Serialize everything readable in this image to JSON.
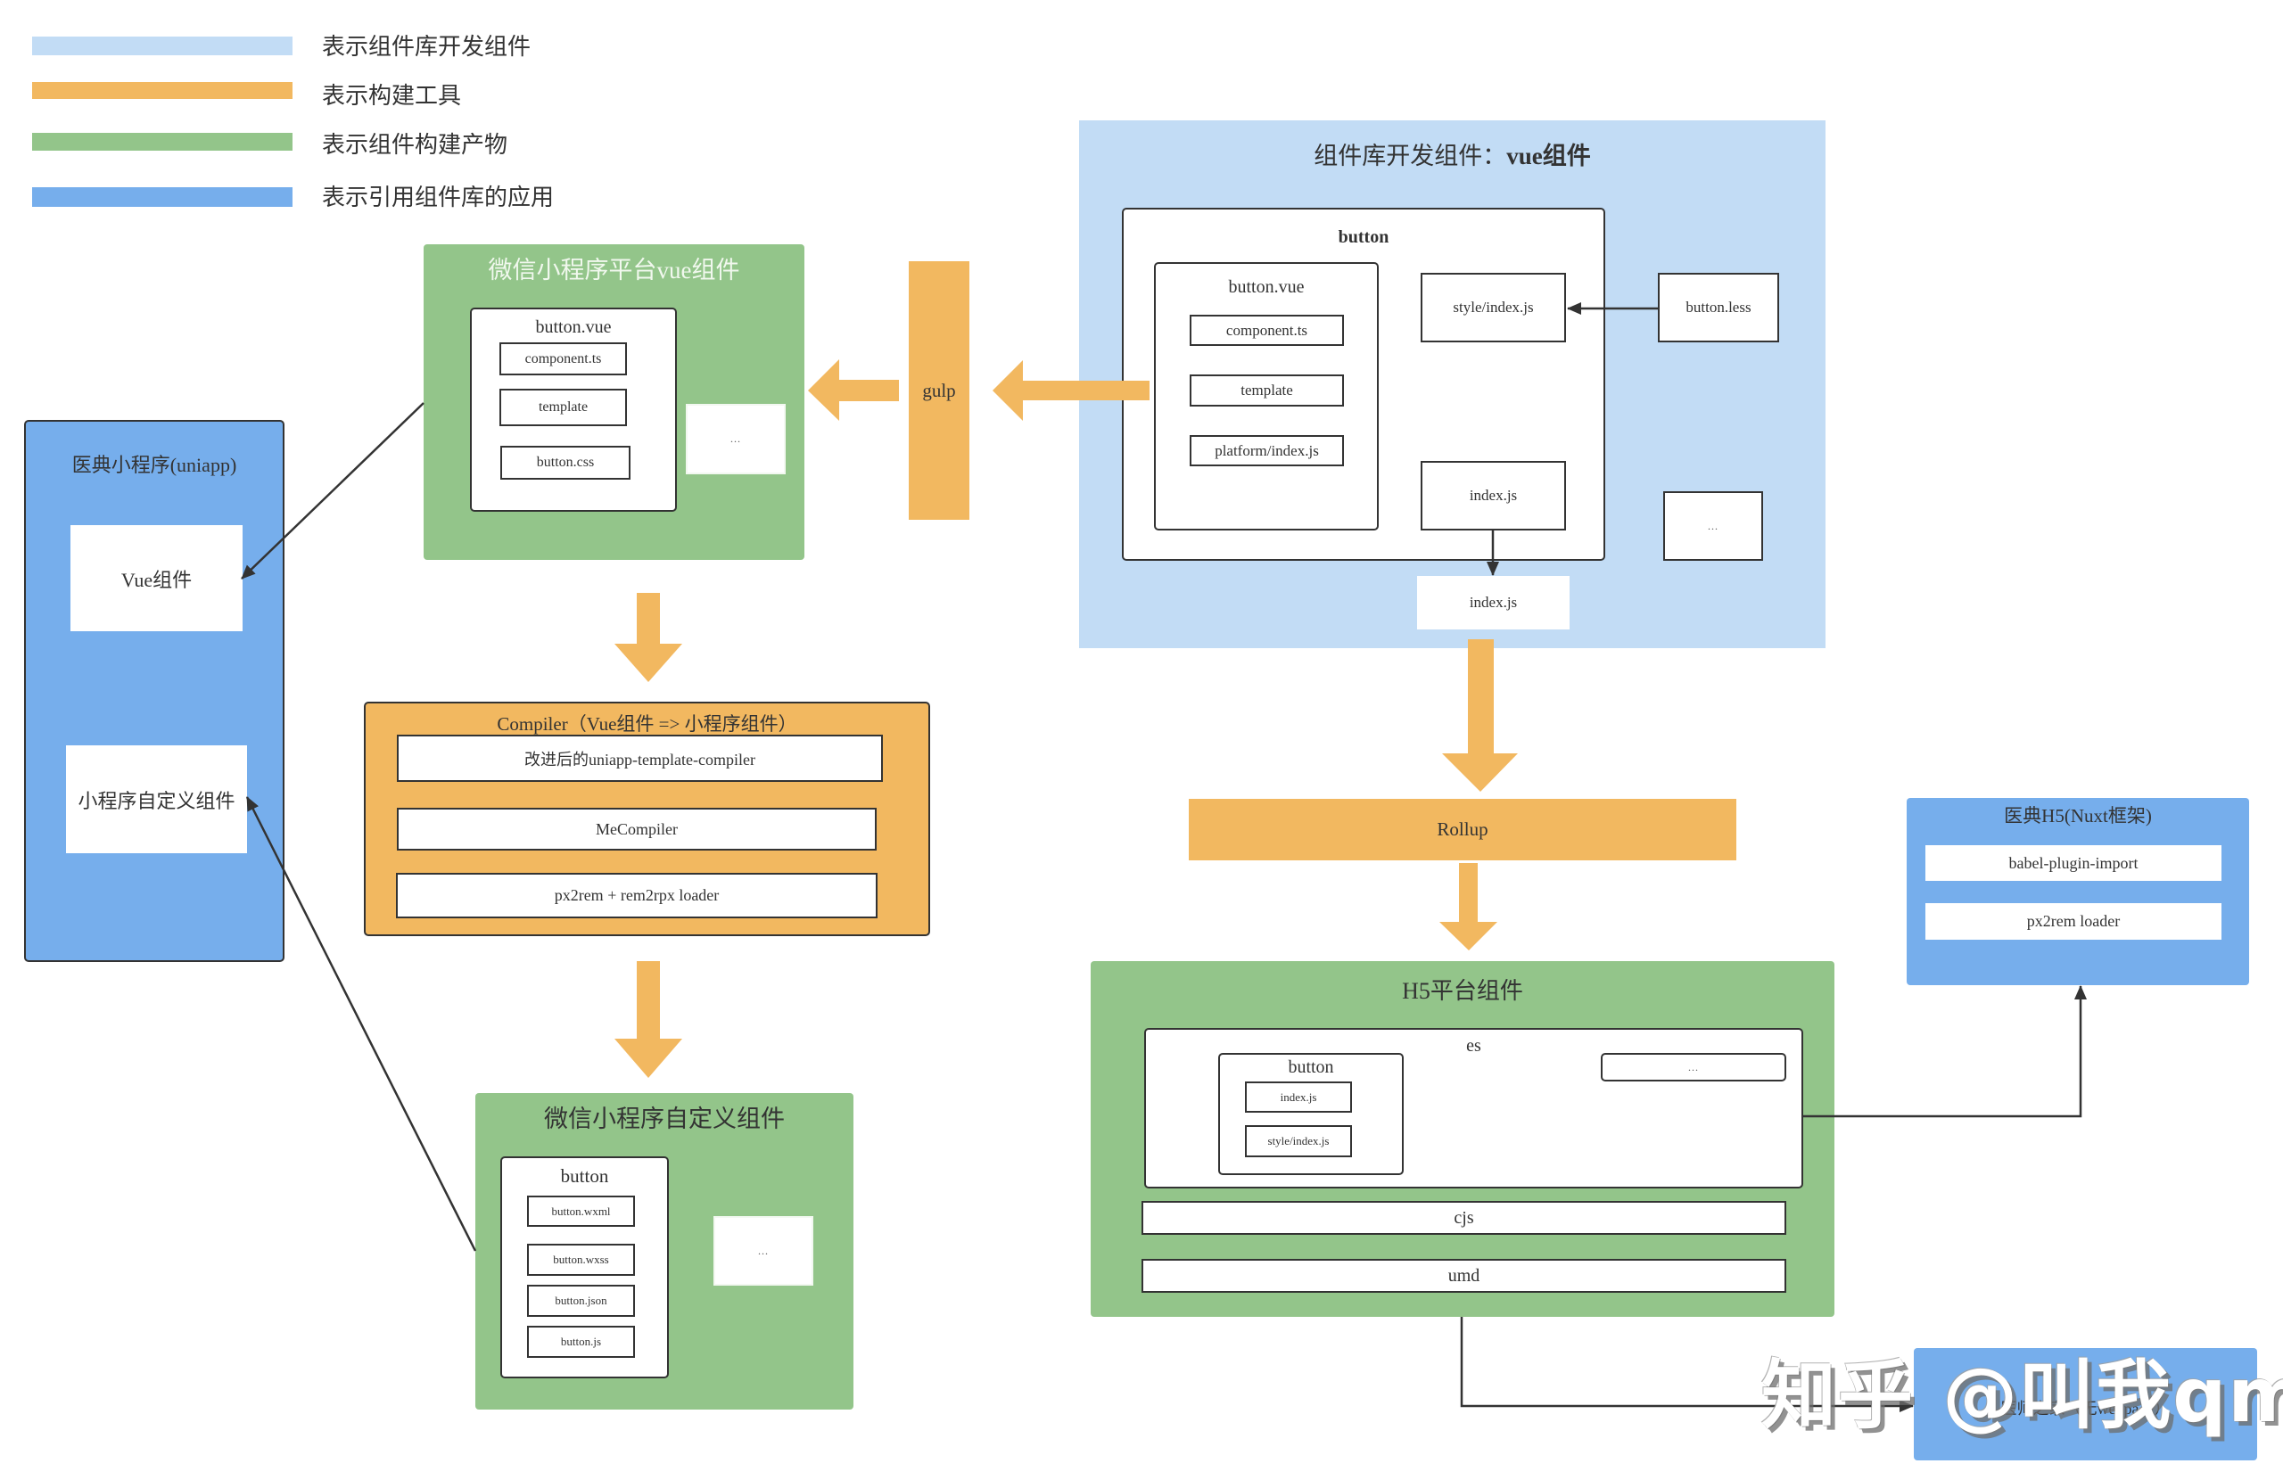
{
  "colors": {
    "dev_library": "#c2dcf5",
    "build_tool": "#f2b860",
    "build_artifact": "#93c58a",
    "consumer_app": "#76aeec",
    "line": "#333333"
  },
  "legend": [
    {
      "label": "表示组件库开发组件",
      "color": "#c2dcf5"
    },
    {
      "label": "表示构建工具",
      "color": "#f2b860"
    },
    {
      "label": "表示组件构建产物",
      "color": "#93c58a"
    },
    {
      "label": "表示引用组件库的应用",
      "color": "#76aeec"
    }
  ],
  "apps": {
    "miniprogram": {
      "title": "医典小程序(uniapp)",
      "items": [
        "Vue组件",
        "小程序自定义组件"
      ]
    },
    "h5": {
      "title": "医典H5(Nuxt框架)",
      "items": [
        "babel-plugin-import",
        "px2rem loader"
      ]
    },
    "doctor_home": {
      "title": "医师之家（无webpack）"
    }
  },
  "dev_library": {
    "title_prefix": "组件库开发组件：",
    "title_bold": "vue组件",
    "component": {
      "name": "button",
      "vue_file": {
        "name": "button.vue",
        "parts": [
          "component.ts",
          "template",
          "platform/index.js"
        ]
      },
      "style_entry": "style/index.js",
      "entry": "index.js"
    },
    "less_file": "button.less",
    "more": "...",
    "output": "index.js"
  },
  "tools": {
    "gulp": "gulp",
    "compiler": {
      "title": "Compiler（Vue组件 => 小程序组件）",
      "items": [
        "改进后的uniapp-template-compiler",
        "MeCompiler",
        "px2rem + rem2rpx loader"
      ]
    },
    "rollup": "Rollup"
  },
  "artifacts": {
    "wx_vue": {
      "title": "微信小程序平台vue组件",
      "component": {
        "name": "button.vue",
        "files": [
          "component.ts",
          "template",
          "button.css"
        ]
      },
      "more": "..."
    },
    "wx_custom": {
      "title": "微信小程序自定义组件",
      "component": {
        "name": "button",
        "files": [
          "button.wxml",
          "button.wxss",
          "button.json",
          "button.js"
        ]
      },
      "more": "..."
    },
    "h5": {
      "title": "H5平台组件",
      "es": {
        "label": "es",
        "component": {
          "name": "button",
          "files": [
            "index.js",
            "style/index.js"
          ]
        },
        "more": "..."
      },
      "formats": [
        "cjs",
        "umd"
      ]
    }
  },
  "watermark": "知乎 @叫我qm"
}
